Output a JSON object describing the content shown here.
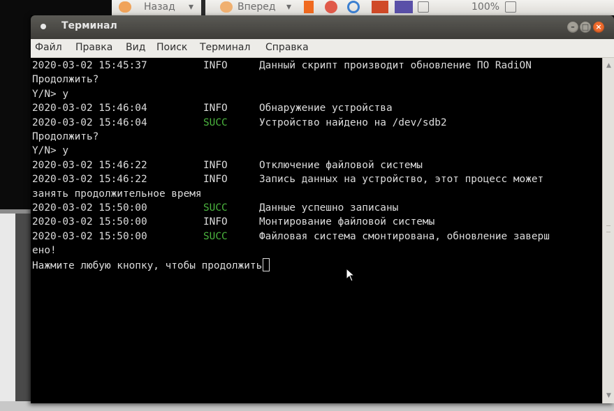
{
  "browser_toolbar": {
    "back_label": "Назад",
    "forward_label": "Вперед",
    "zoom_level": "100%"
  },
  "window": {
    "title": "Терминал"
  },
  "menu": {
    "items": [
      "Файл",
      "Правка",
      "Вид",
      "Поиск",
      "Терминал",
      "Справка"
    ]
  },
  "terminal": {
    "lines": [
      {
        "date": "2020-03-02 15:45:37",
        "level": "INFO",
        "message": "Данный скрипт производит обновление ПО RadiON"
      },
      {
        "text": "Продолжить?"
      },
      {
        "text": "Y/N> y"
      },
      {
        "date": "2020-03-02 15:46:04",
        "level": "INFO",
        "message": "Обнаружение устройства"
      },
      {
        "date": "2020-03-02 15:46:04",
        "level": "SUCC",
        "message": "Устройство найдено на /dev/sdb2"
      },
      {
        "text": "Продолжить?"
      },
      {
        "text": "Y/N> y"
      },
      {
        "date": "2020-03-02 15:46:22",
        "level": "INFO",
        "message": "Отключение файловой системы"
      },
      {
        "date": "2020-03-02 15:46:22",
        "level": "INFO",
        "message": "Запись данных на устройство, этот процесс может"
      },
      {
        "text": "занять продолжительное время"
      },
      {
        "date": "2020-03-02 15:50:00",
        "level": "SUCC",
        "message": "Данные успешно записаны"
      },
      {
        "date": "2020-03-02 15:50:00",
        "level": "INFO",
        "message": "Монтирование файловой системы"
      },
      {
        "date": "2020-03-02 15:50:00",
        "level": "SUCC",
        "message": "Файловая система смонтирована, обновление заверш"
      },
      {
        "text": "ено!"
      },
      {
        "text": "Нажмите любую кнопку, чтобы продолжить",
        "cursor": true
      }
    ],
    "colors": {
      "background": "#000000",
      "text": "#dcdcdc",
      "succ": "#4bb53e"
    }
  }
}
